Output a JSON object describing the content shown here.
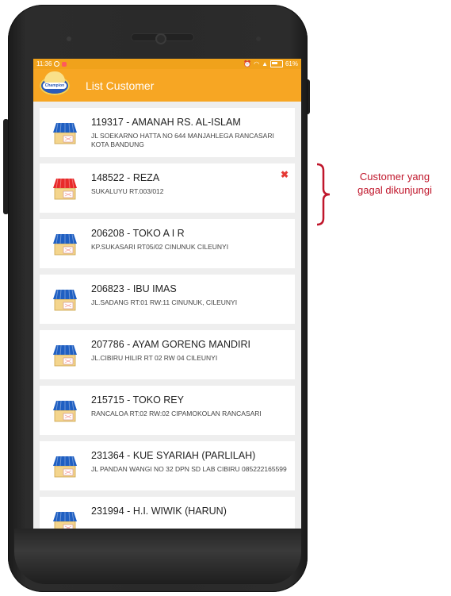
{
  "status_bar": {
    "time": "11:36",
    "battery_percent": "61%"
  },
  "app_bar": {
    "title": "List Customer",
    "logo_text": "Champion"
  },
  "customers": [
    {
      "title": "119317 - AMANAH RS. AL-ISLAM",
      "address": "JL SOEKARNO HATTA NO 644 MANJAHLEGA RANCASARI KOTA BANDUNG",
      "status": "normal"
    },
    {
      "title": "148522 - REZA",
      "address": "SUKALUYU RT.003/012",
      "status": "failed"
    },
    {
      "title": "206208 - TOKO A I R",
      "address": "KP.SUKASARI RT05/02 CINUNUK CILEUNYI",
      "status": "normal"
    },
    {
      "title": "206823 - IBU IMAS",
      "address": "JL.SADANG RT:01 RW:11 CINUNUK, CILEUNYI",
      "status": "normal"
    },
    {
      "title": "207786 - AYAM GORENG MANDIRI",
      "address": "JL.CIBIRU HILIR RT 02 RW 04 CILEUNYI",
      "status": "normal"
    },
    {
      "title": "215715 - TOKO REY",
      "address": "RANCALOA RT:02 RW:02 CIPAMOKOLAN RANCASARI",
      "status": "normal"
    },
    {
      "title": "231364 - KUE SYARIAH (PARLILAH)",
      "address": "JL PANDAN WANGI NO 32 DPN SD LAB CIBIRU 085222165599",
      "status": "normal"
    },
    {
      "title": "231994 - H.I. WIWIK (HARUN)",
      "address": "",
      "status": "normal"
    }
  ],
  "annotation": {
    "line1": "Customer yang",
    "line2": "gagal dikunjungi"
  },
  "colors": {
    "app_bar": "#f7a623",
    "status_bar": "#f0a21b",
    "store_normal_awning": "#1f5fc2",
    "store_failed_awning": "#e82a2a",
    "annotation": "#c0162b",
    "close_icon": "#e53935"
  }
}
